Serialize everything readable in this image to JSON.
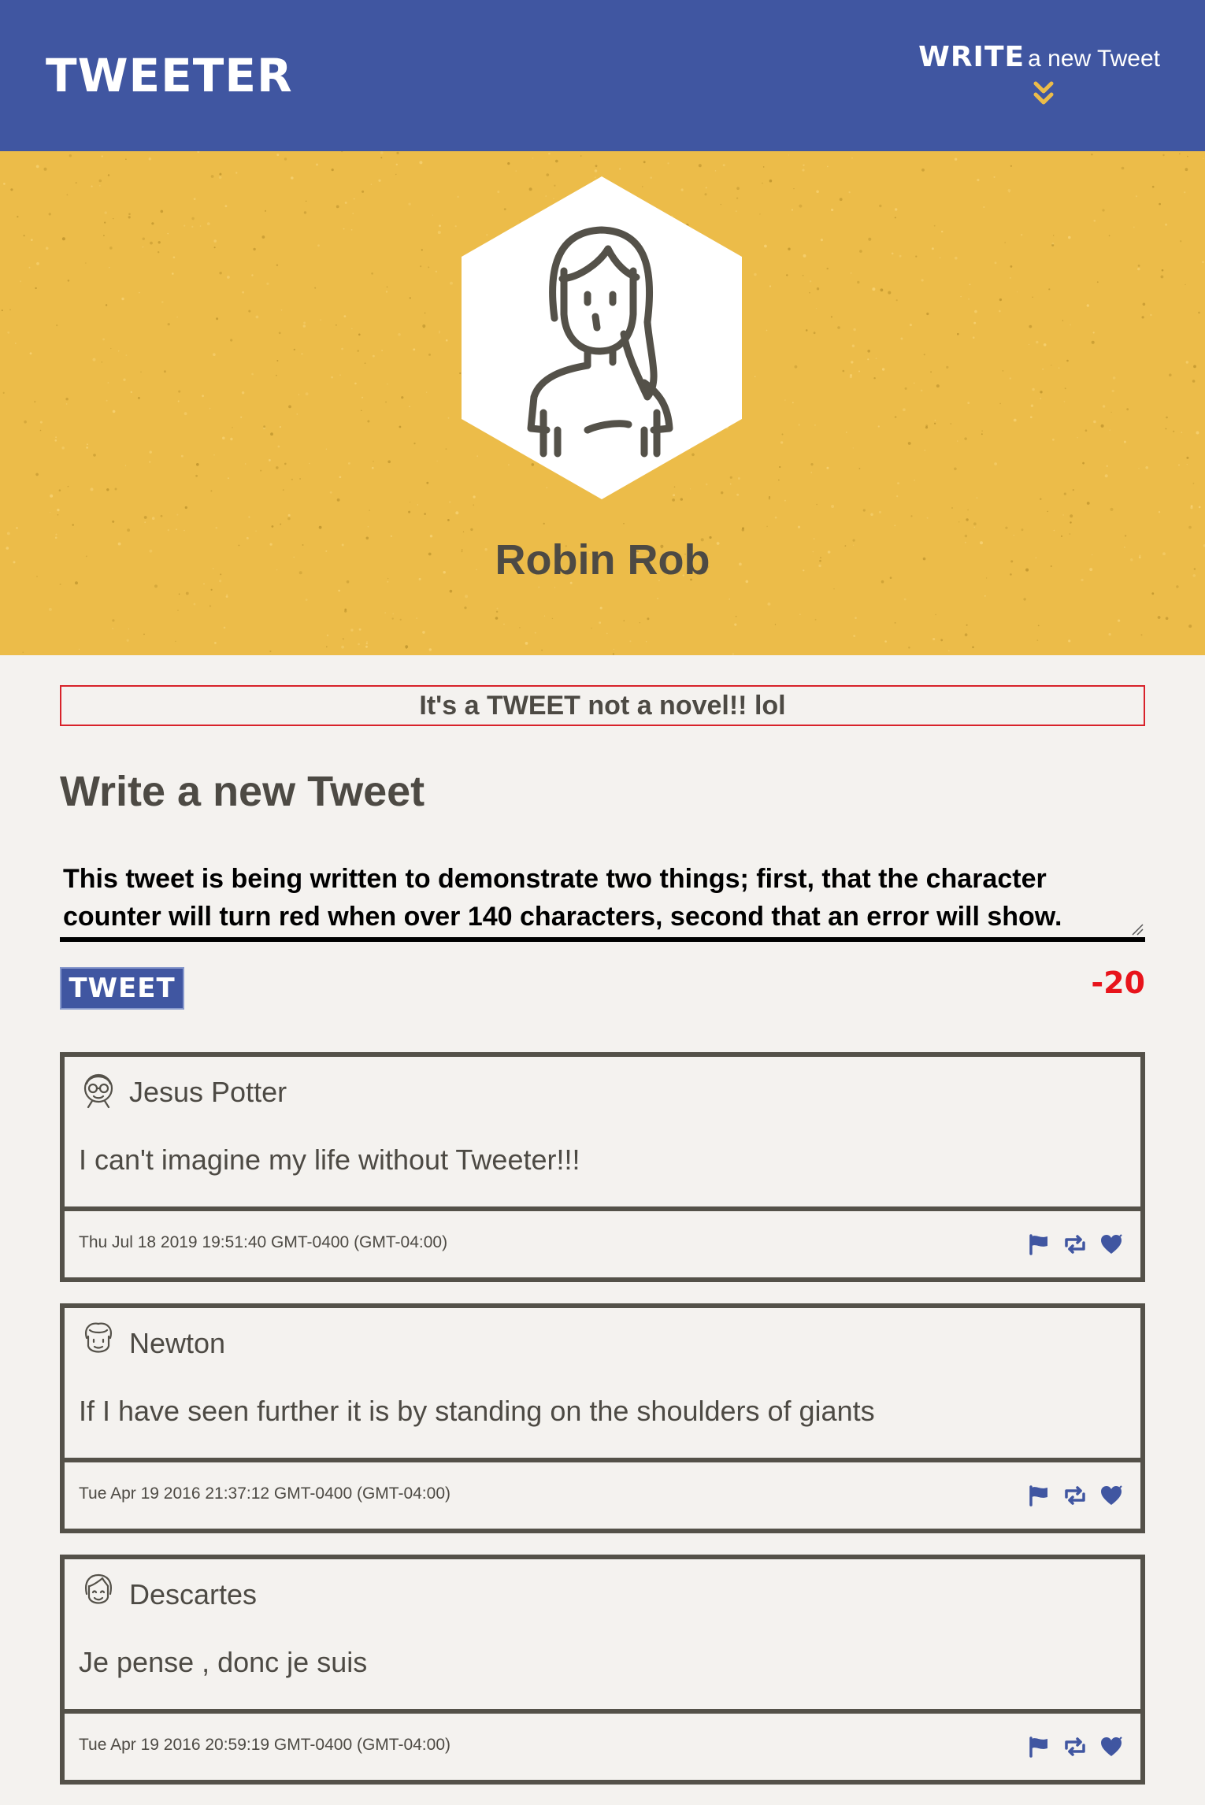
{
  "nav": {
    "brand": "TWEETER",
    "compose_strong": "WRITE",
    "compose_rest": "a new Tweet",
    "compose_icon": "double-chevron-down-icon"
  },
  "profile": {
    "name": "Robin Rob",
    "avatar_icon": "woman-avatar-icon"
  },
  "composer": {
    "error": "It's a TWEET not a novel!! lol",
    "title": "Write a new Tweet",
    "text": "This tweet is being written to demonstrate two things; first, that the character counter will turn red when over 140 characters, second that an error will show.",
    "button_label": "TWEET",
    "counter": "-20"
  },
  "tweets": [
    {
      "author": "Jesus Potter",
      "content": "I can't imagine my life without Tweeter!!!",
      "date": "Thu Jul 18 2019 19:51:40 GMT-0400 (GMT-04:00)",
      "avatar_icon": "glasses-face-icon"
    },
    {
      "author": "Newton",
      "content": "If I have seen further it is by standing on the shoulders of giants",
      "date": "Tue Apr 19 2016 21:37:12 GMT-0400 (GMT-04:00)",
      "avatar_icon": "curly-hair-face-icon"
    },
    {
      "author": "Descartes",
      "content": "Je pense , donc je suis",
      "date": "Tue Apr 19 2016 20:59:19 GMT-0400 (GMT-04:00)",
      "avatar_icon": "smiling-face-icon"
    }
  ],
  "colors": {
    "nav": "#4056a1",
    "header": "#ecbc49",
    "background": "#f4f2ef",
    "text": "#4d4a44",
    "error": "#d8222a",
    "counter_over": "#e8141b",
    "action_icons": "#4056a1"
  }
}
